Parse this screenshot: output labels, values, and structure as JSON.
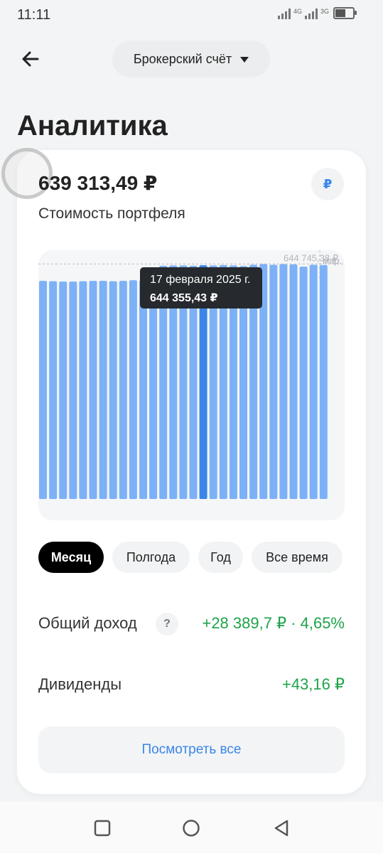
{
  "status": {
    "time": "11:11",
    "net1": "4G",
    "net2": "3G"
  },
  "header": {
    "account": "Брокерский счёт"
  },
  "page": {
    "title": "Аналитика"
  },
  "portfolio": {
    "total": "639 313,49 ₽",
    "label": "Стоимость портфеля",
    "currency_symbol": "₽"
  },
  "chart_data": {
    "type": "bar",
    "values": [
      639500,
      639400,
      639300,
      639300,
      639400,
      639500,
      639500,
      639400,
      639500,
      639700,
      639600,
      640600,
      644200,
      644300,
      644300,
      644200,
      644355.43,
      644300,
      644400,
      644300,
      644100,
      644500,
      644745.38,
      644500,
      644700,
      644600,
      643900,
      644500,
      644400
    ],
    "highlight_index": 16,
    "ylim": [
      572000,
      649000
    ],
    "reference_value": "644 745,38 ₽",
    "right_label": "мар.",
    "tooltip_date": "17 февраля 2025 г.",
    "tooltip_value": "644 355,43 ₽",
    "bar_color": "#7db1f7",
    "highlight_color": "#3a86e8"
  },
  "periods": [
    {
      "label": "Месяц",
      "active": true
    },
    {
      "label": "Полгода",
      "active": false
    },
    {
      "label": "Год",
      "active": false
    },
    {
      "label": "Все время",
      "active": false
    }
  ],
  "income": {
    "label": "Общий доход",
    "help": "?",
    "value": "+28 389,7 ₽ · 4,65%"
  },
  "dividends": {
    "label": "Дивиденды",
    "value": "+43,16 ₽"
  },
  "see_all": "Посмотреть все",
  "colors": {
    "accent": "#3a86e8",
    "positive": "#1ea34a"
  }
}
